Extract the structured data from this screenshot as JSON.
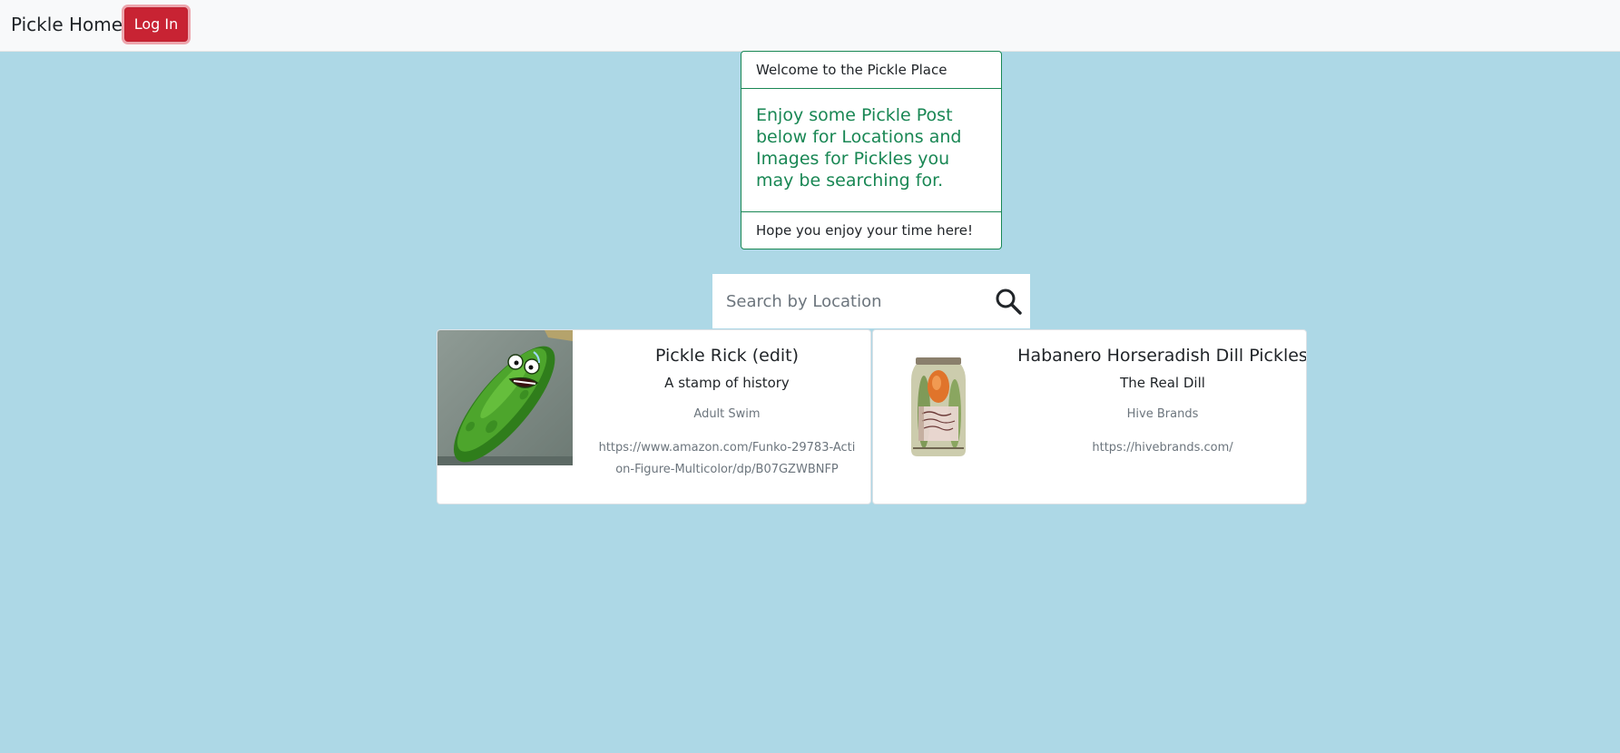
{
  "navbar": {
    "brand": "Pickle Home",
    "login_label": "Log In"
  },
  "welcome": {
    "header": "Welcome to the Pickle Place",
    "headline": "Enjoy some Pickle Post below for Locations and Images for Pickles you may be searching for.",
    "footer": "Hope you enjoy your time here!"
  },
  "search": {
    "placeholder": "Search by Location",
    "value": "",
    "icon": "search-icon"
  },
  "posts": [
    {
      "title": "Pickle Rick (edit)",
      "subtitle": "A stamp of history",
      "location": "Adult Swim",
      "link": "https://www.amazon.com/Funko-29783-Action-Figure-Multicolor/dp/B07GZWBNFP",
      "image": "pickle-rick-cartoon"
    },
    {
      "title": "Habanero Horseradish Dill Pickles",
      "subtitle": "The Real Dill",
      "location": "Hive Brands",
      "link": "https://hivebrands.com/",
      "image": "pickle-jar"
    }
  ],
  "colors": {
    "page_background": "#add8e6",
    "navbar_background": "#f8f9fa",
    "login_button": "#c82333",
    "accent_green": "#198754"
  }
}
